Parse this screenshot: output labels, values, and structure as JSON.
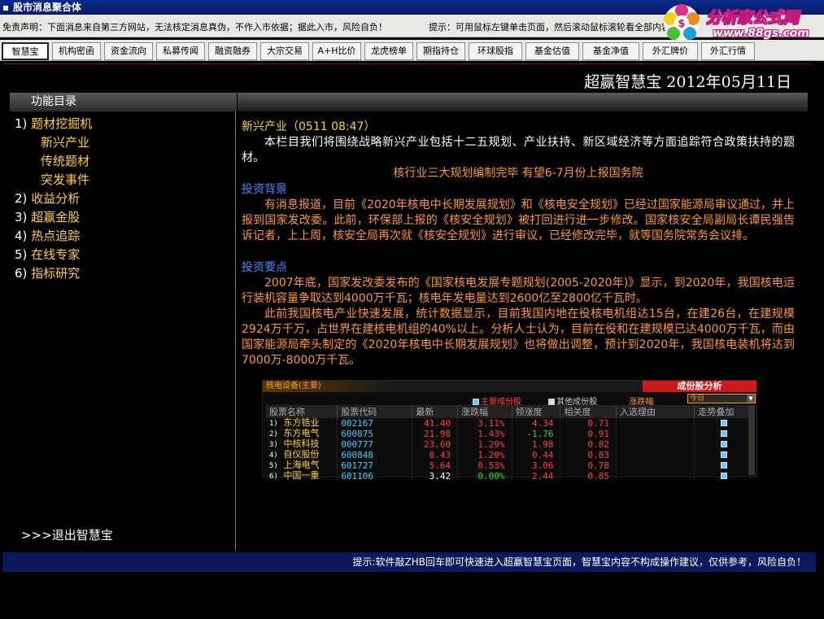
{
  "window": {
    "title": "股市消息聚合体"
  },
  "disclaimer": {
    "text": "免责声明：下面消息来自第三方网站，无法核定消息真伪，不作入市依据；据此入市，风险自负！",
    "tip": "提示：可用鼠标左键单击页面，然后滚动鼠标滚轮看全部内容"
  },
  "logo": {
    "name": "分析家公式网",
    "url": "www.88gs.com"
  },
  "tabs": [
    "智慧宝",
    "机构密函",
    "资金流向",
    "私募传闻",
    "融资融券",
    "大宗交易",
    "A+H比价",
    "龙虎榜单",
    "期指持仓",
    "环球股指",
    "基金估值",
    "基金净值",
    "外汇牌价",
    "外汇行情"
  ],
  "active_tab": "智慧宝",
  "header": {
    "title": "超赢智慧宝  2012年05月11日"
  },
  "sidebar": {
    "heading": "功能目录",
    "items": [
      {
        "num": "1)",
        "label": "题材挖掘机"
      },
      {
        "num": "",
        "label": "新兴产业",
        "sub": true
      },
      {
        "num": "",
        "label": "传统题材",
        "sub": true
      },
      {
        "num": "",
        "label": "突发事件",
        "sub": true
      },
      {
        "num": "2)",
        "label": "收益分析"
      },
      {
        "num": "3)",
        "label": "超赢金股"
      },
      {
        "num": "4)",
        "label": "热点追踪"
      },
      {
        "num": "5)",
        "label": "在线专家"
      },
      {
        "num": "6)",
        "label": "指标研究"
      }
    ],
    "exit": ">>>退出智慧宝"
  },
  "content": {
    "section_title": "新兴产业（0511   08:47）",
    "intro": "本栏目我们将围绕战略新兴产业包括十二五规划、产业扶持、新区域经济等方面追踪符合政策扶持的题材。",
    "headline": "核行业三大规划编制完毕 有望6-7月份上报国务院",
    "bg_label": "投资背景",
    "bg_text": "有消息报道，目前《2020年核电中长期发展规划》和《核电安全规划》已经过国家能源局审议通过，并上报到国家发改委。此前，环保部上报的《核安全规划》被打回进行进一步修改。国家核安全局副局长谭民强告诉记者，上上周，核安全局再次就《核安全规划》进行审议，已经修改完毕，就等国务院常务会议排。",
    "points_label": "投资要点",
    "points_text_1": "2007年底，国家发改委发布的《国家核电发展专题规划(2005-2020年)》显示，到2020年，我国核电运行装机容量争取达到4000万千瓦；核电年发电量达到2600亿至2800亿千瓦时。",
    "points_text_2": "此前我国核电产业快速发展，统计数据显示，目前我国内地在役核电机组达15台，在建26台，在建规模2924万千万，占世界在建核电机组的40%以上。分析人士认为，目前在役和在建规模已达4000万千瓦，而由国家能源局牵头制定的《2020年核电中长期发展规划》也将做出调整，预计到2020年，我国核电装机将达到7000万-8000万千瓦。"
  },
  "stock_panel": {
    "top_left": "核电设备(主要)",
    "title": "成份股分析",
    "legend_main": "主要成份股",
    "legend_other": "其他成份股",
    "sort_label": "涨跌幅",
    "period": "今日",
    "columns": [
      "股票名称",
      "股票代码",
      "最新",
      "涨跌幅",
      "领涨度",
      "相关度",
      "入选理由",
      "走势叠加"
    ],
    "rows": [
      {
        "idx": "1)",
        "name": "东方锆业",
        "code": "002167",
        "price": "41.40",
        "chg": "3.11%",
        "lead": "4.34",
        "corr": "0.71",
        "dir": "up"
      },
      {
        "idx": "2)",
        "name": "东方电气",
        "code": "600875",
        "price": "21.98",
        "chg": "1.43%",
        "lead": "-1.76",
        "corr": "0.91",
        "dir": "up"
      },
      {
        "idx": "3)",
        "name": "中核科技",
        "code": "000777",
        "price": "23.60",
        "chg": "1.29%",
        "lead": "1.98",
        "corr": "0.82",
        "dir": "up"
      },
      {
        "idx": "4)",
        "name": "自仪股份",
        "code": "600848",
        "price": "8.43",
        "chg": "1.20%",
        "lead": "0.44",
        "corr": "0.83",
        "dir": "up"
      },
      {
        "idx": "5)",
        "name": "上海电气",
        "code": "601727",
        "price": "5.64",
        "chg": "0.53%",
        "lead": "3.06",
        "corr": "0.78",
        "dir": "up"
      },
      {
        "idx": "6)",
        "name": "中国一重",
        "code": "601106",
        "price": "3.42",
        "chg": "0.00%",
        "lead": "2.44",
        "corr": "0.85",
        "dir": "flat"
      }
    ]
  },
  "bottom": {
    "tip": "提示:软件敲ZHB回车即可快速进入超赢智慧宝页面，智慧宝内容不构成操作建议，仅供参考，风险自负！"
  }
}
